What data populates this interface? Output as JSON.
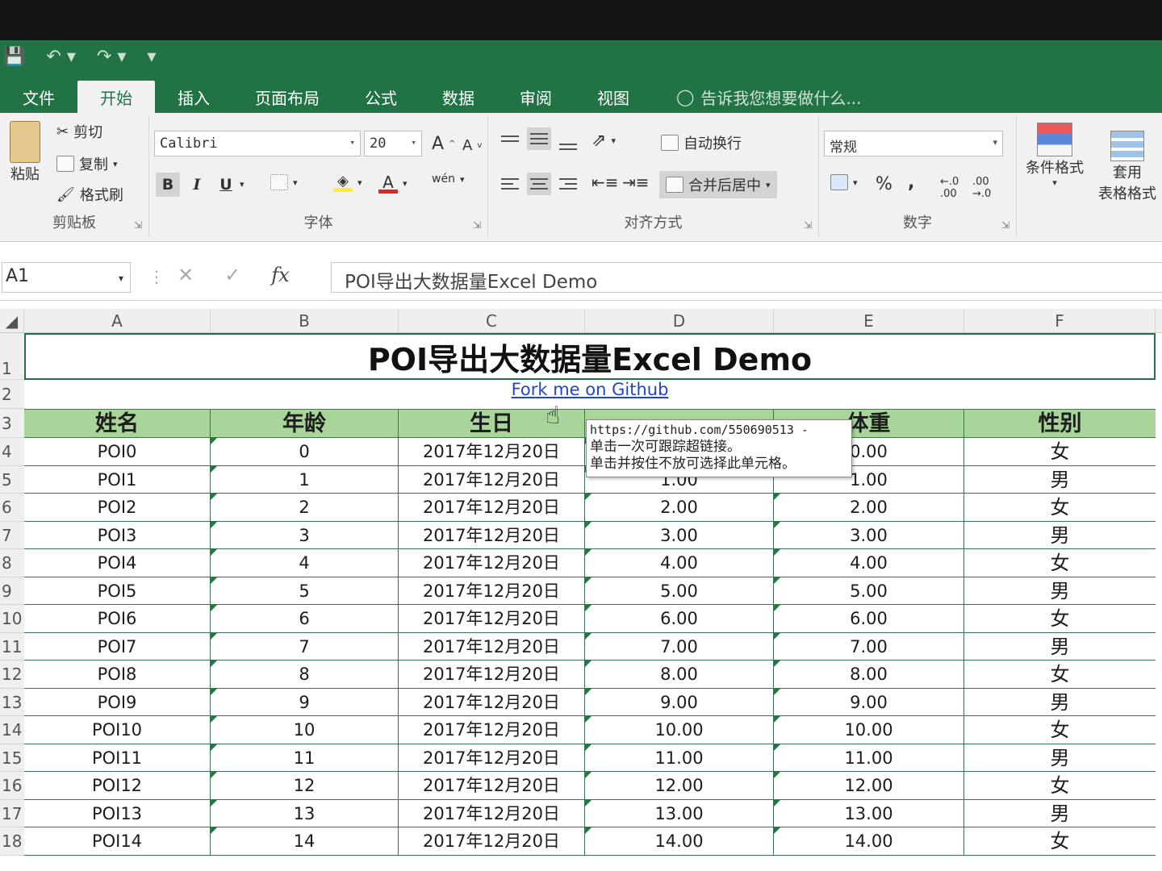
{
  "qat": {
    "save_icon": "save-icon",
    "undo_icon": "undo-icon",
    "redo_icon": "redo-icon",
    "customize_icon": "customize-qat-icon"
  },
  "tabs": [
    {
      "label": "文件"
    },
    {
      "label": "开始"
    },
    {
      "label": "插入"
    },
    {
      "label": "页面布局"
    },
    {
      "label": "公式"
    },
    {
      "label": "数据"
    },
    {
      "label": "审阅"
    },
    {
      "label": "视图"
    }
  ],
  "tell_me": "告诉我您想要做什么...",
  "clipboard": {
    "paste": "粘贴",
    "cut": "剪切",
    "copy": "复制",
    "painter": "格式刷",
    "label": "剪贴板"
  },
  "font": {
    "name": "Calibri",
    "size": "20",
    "bold": "B",
    "italic": "I",
    "underline": "U",
    "grow": "A",
    "shrink": "A",
    "phonetic": "wén",
    "label": "字体"
  },
  "alignment": {
    "wrap": "自动换行",
    "merge": "合并后居中",
    "label": "对齐方式"
  },
  "number": {
    "format": "常规",
    "percent": "%",
    "comma": ",",
    "label": "数字"
  },
  "styles": {
    "conditional": "条件格式",
    "table_line1": "套用",
    "table_line2": "表格格式"
  },
  "formula_bar": {
    "name_box": "A1",
    "cancel": "✕",
    "enter": "✓",
    "fx": "fx",
    "content": "POI导出大数据量Excel Demo"
  },
  "columns": [
    "A",
    "B",
    "C",
    "D",
    "E",
    "F"
  ],
  "sheet": {
    "title": "POI导出大数据量Excel Demo",
    "link": "Fork me on Github",
    "headers": [
      "姓名",
      "年龄",
      "生日",
      "",
      "体重",
      "性别"
    ],
    "rows": [
      [
        "POI0",
        "0",
        "2017年12月20日",
        "",
        "0.00",
        "女"
      ],
      [
        "POI1",
        "1",
        "2017年12月20日",
        "1.00",
        "1.00",
        "男"
      ],
      [
        "POI2",
        "2",
        "2017年12月20日",
        "2.00",
        "2.00",
        "女"
      ],
      [
        "POI3",
        "3",
        "2017年12月20日",
        "3.00",
        "3.00",
        "男"
      ],
      [
        "POI4",
        "4",
        "2017年12月20日",
        "4.00",
        "4.00",
        "女"
      ],
      [
        "POI5",
        "5",
        "2017年12月20日",
        "5.00",
        "5.00",
        "男"
      ],
      [
        "POI6",
        "6",
        "2017年12月20日",
        "6.00",
        "6.00",
        "女"
      ],
      [
        "POI7",
        "7",
        "2017年12月20日",
        "7.00",
        "7.00",
        "男"
      ],
      [
        "POI8",
        "8",
        "2017年12月20日",
        "8.00",
        "8.00",
        "女"
      ],
      [
        "POI9",
        "9",
        "2017年12月20日",
        "9.00",
        "9.00",
        "男"
      ],
      [
        "POI10",
        "10",
        "2017年12月20日",
        "10.00",
        "10.00",
        "女"
      ],
      [
        "POI11",
        "11",
        "2017年12月20日",
        "11.00",
        "11.00",
        "男"
      ],
      [
        "POI12",
        "12",
        "2017年12月20日",
        "12.00",
        "12.00",
        "女"
      ],
      [
        "POI13",
        "13",
        "2017年12月20日",
        "13.00",
        "13.00",
        "男"
      ],
      [
        "POI14",
        "14",
        "2017年12月20日",
        "14.00",
        "14.00",
        "女"
      ]
    ]
  },
  "tooltip": {
    "url": "https://github.com/550690513 -",
    "line1": "单击一次可跟踪超链接。",
    "line2": "单击并按住不放可选择此单元格。"
  }
}
